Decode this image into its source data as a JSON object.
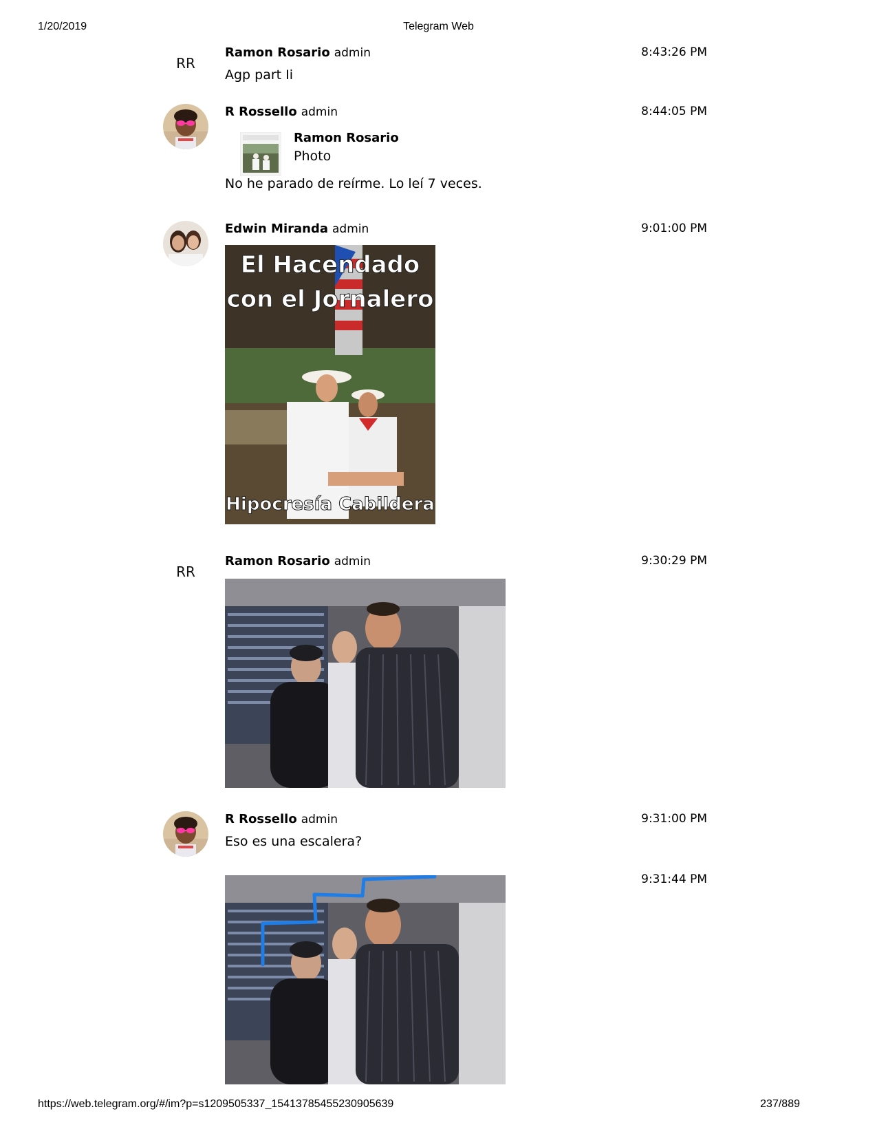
{
  "print_header": {
    "date": "1/20/2019",
    "title": "Telegram Web"
  },
  "print_footer": {
    "url": "https://web.telegram.org/#/im?p=s1209505337_15413785455230905639",
    "page": "237/889"
  },
  "messages": [
    {
      "author": "Ramon Rosario",
      "role": "admin",
      "time": "8:43:26 PM",
      "avatar_initials": "RR",
      "text": "Agp part Ii"
    },
    {
      "author": "R Rossello",
      "role": "admin",
      "time": "8:44:05 PM",
      "avatar": "child-with-pink-sunglasses-avatar",
      "reply": {
        "author": "Ramon Rosario",
        "kind": "Photo"
      },
      "text": "No he parado de reírme.  Lo leí 7 veces."
    },
    {
      "author": "Edwin Miranda",
      "role": "admin",
      "time": "9:01:00 PM",
      "avatar": "two-people-avatar",
      "photo": {
        "caption_top_1": "El Hacendado",
        "caption_top_2": "con el Jornalero",
        "caption_bottom": "Hipocresía Cabildera"
      }
    },
    {
      "author": "Ramon Rosario",
      "role": "admin",
      "time": "9:30:29 PM",
      "avatar_initials": "RR",
      "photo": "three-men-stadium-photo"
    },
    {
      "author": "R Rossello",
      "role": "admin",
      "time": "9:31:00 PM",
      "avatar": "child-with-pink-sunglasses-avatar",
      "text": "Eso es una escalera?"
    },
    {
      "time": "9:31:44 PM",
      "photo": "three-men-stadium-photo-with-blue-stair-line"
    }
  ],
  "colors": {
    "drawn_line": "#1e7de6",
    "avatar_sunglasses": "#ff3aa0"
  }
}
